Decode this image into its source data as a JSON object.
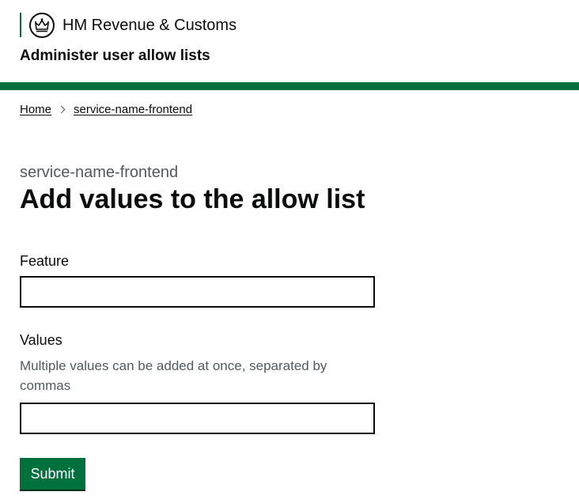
{
  "header": {
    "organisation_name": "HM Revenue & Customs",
    "crest_icon": "crown-icon",
    "service_name": "Administer user allow lists",
    "accent_color": "#00703c"
  },
  "breadcrumbs": {
    "items": [
      {
        "label": "Home"
      },
      {
        "label": "service-name-frontend"
      }
    ],
    "separator_icon": "chevron-right-icon"
  },
  "main": {
    "caption": "service-name-frontend",
    "title": "Add values to the allow list",
    "feature_field": {
      "label": "Feature",
      "value": ""
    },
    "values_field": {
      "label": "Values",
      "hint": "Multiple values can be added at once, separated by commas",
      "value": ""
    },
    "submit_label": "Submit"
  }
}
